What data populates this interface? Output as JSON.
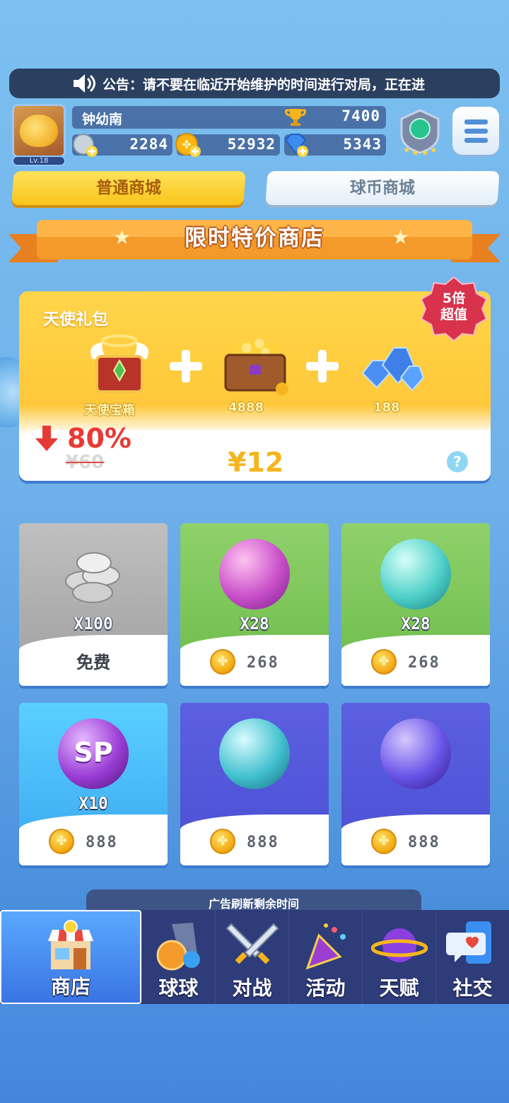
{
  "announcement": {
    "text": "公告：请不要在临近开始维护的时间进行对局，正在进"
  },
  "profile": {
    "level": "Lv.18",
    "name": "钟幼南",
    "trophies": "7400",
    "silver": "2284",
    "coins": "52932",
    "gems": "5343"
  },
  "tabs": {
    "normal": "普通商城",
    "ball_coin": "球币商城"
  },
  "section_title": "限时特价商店",
  "pack": {
    "title": "天使礼包",
    "badge_line1": "5倍",
    "badge_line2": "超值",
    "items": [
      {
        "label": "天使宝箱",
        "icon": "angel-chest-icon"
      },
      {
        "label": "4888",
        "icon": "gold-chest-icon"
      },
      {
        "label": "188",
        "icon": "gems-pile-icon"
      }
    ],
    "discount": "80%",
    "old_price": "¥60",
    "new_price": "¥12",
    "help": "?"
  },
  "products": [
    {
      "qty": "X100",
      "price": "",
      "free_label": "免费",
      "icon": "silver-coins-icon",
      "theme": "gray"
    },
    {
      "qty": "X28",
      "price": "268",
      "icon": "pink-arrow-orb-icon",
      "theme": "green"
    },
    {
      "qty": "X28",
      "price": "268",
      "icon": "teal-swirl-orb-icon",
      "theme": "green"
    },
    {
      "qty": "X10",
      "price": "888",
      "icon": "sp-orb-icon",
      "theme": "blue"
    },
    {
      "qty": "",
      "price": "888",
      "icon": "cyan-vortex-orb-icon",
      "theme": "purple"
    },
    {
      "qty": "",
      "price": "888",
      "icon": "purple-swap-orb-icon",
      "theme": "purple"
    }
  ],
  "ad_timer": "广告刷新剩余时间",
  "nav": [
    {
      "label": "商店",
      "icon": "shop-icon"
    },
    {
      "label": "球球",
      "icon": "ball-icon"
    },
    {
      "label": "对战",
      "icon": "crossed-swords-icon"
    },
    {
      "label": "活动",
      "icon": "party-popper-icon"
    },
    {
      "label": "天赋",
      "icon": "planet-icon"
    },
    {
      "label": "社交",
      "icon": "chat-heart-icon"
    }
  ],
  "colors": {
    "accent_yellow": "#f8c51b",
    "nav_bg": "#2e3c7a",
    "price_orange": "#f6b51d",
    "discount_red": "#e83a35"
  }
}
